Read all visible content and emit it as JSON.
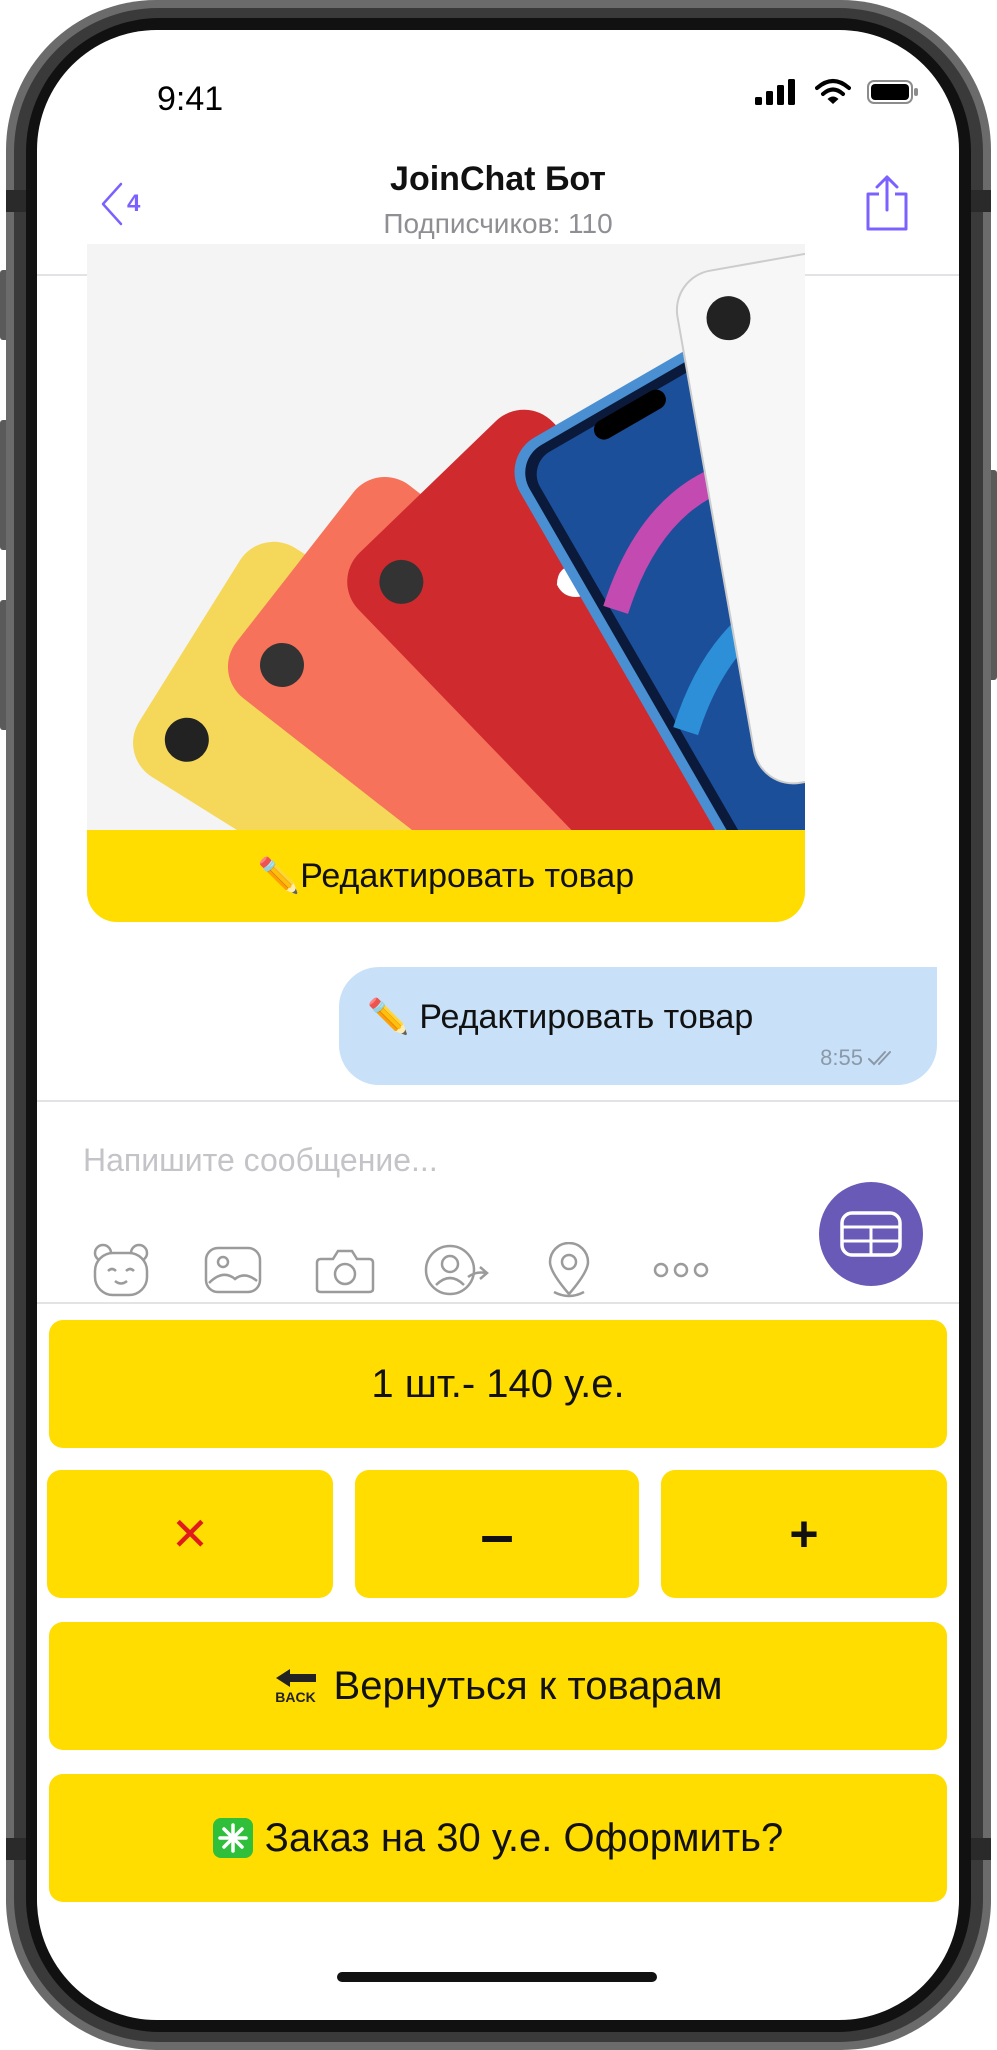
{
  "status": {
    "time": "9:41"
  },
  "header": {
    "back_count": "4",
    "title": "JoinChat Бот",
    "subtitle": "Подписчиков: 110"
  },
  "messages": {
    "card": {
      "button_emoji": "✏️",
      "button_label": "Редактировать товар"
    },
    "outgoing": {
      "emoji": "✏️",
      "text": "Редактировать товар",
      "time": "8:55"
    }
  },
  "input": {
    "placeholder": "Напишите сообщение..."
  },
  "toolbar": {
    "icons": [
      "sticker-icon",
      "gallery-icon",
      "camera-icon",
      "share-contact-icon",
      "location-icon",
      "more-icon"
    ]
  },
  "keyboard": {
    "price_label": "1 шт.- 140 у.е.",
    "remove_label": "✕",
    "minus_label": "–",
    "plus_label": "+",
    "back_label": "Вернуться к товарам",
    "back_icon_text": "BACK",
    "order_label": "Заказ на 30 у.е. Оформить?"
  },
  "colors": {
    "accent": "#7b61ff",
    "keyboard_button": "#ffdd00",
    "outgoing_bubble": "#c8e0f8",
    "kb_toggle": "#6a5ab8",
    "remove": "#e01b1b"
  }
}
